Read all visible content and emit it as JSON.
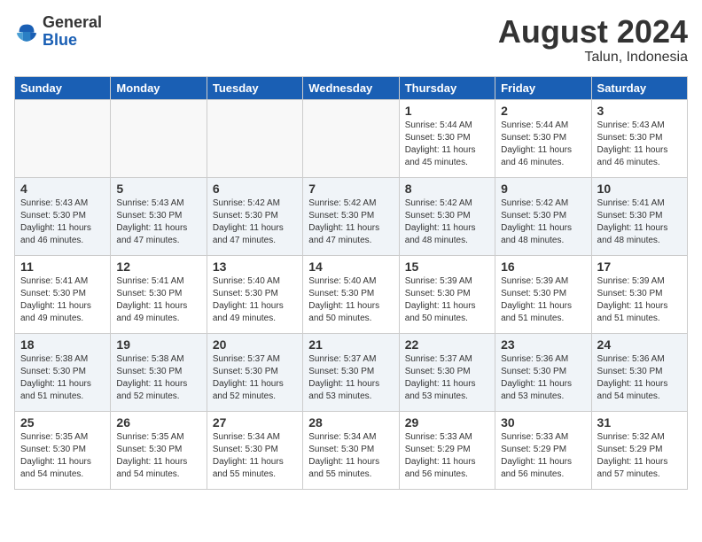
{
  "logo": {
    "general": "General",
    "blue": "Blue"
  },
  "title": {
    "month_year": "August 2024",
    "location": "Talun, Indonesia"
  },
  "headers": [
    "Sunday",
    "Monday",
    "Tuesday",
    "Wednesday",
    "Thursday",
    "Friday",
    "Saturday"
  ],
  "weeks": [
    [
      {
        "day": "",
        "empty": true
      },
      {
        "day": "",
        "empty": true
      },
      {
        "day": "",
        "empty": true
      },
      {
        "day": "",
        "empty": true
      },
      {
        "day": "1",
        "sunrise": "5:44 AM",
        "sunset": "5:30 PM",
        "daylight": "11 hours and 45 minutes."
      },
      {
        "day": "2",
        "sunrise": "5:44 AM",
        "sunset": "5:30 PM",
        "daylight": "11 hours and 46 minutes."
      },
      {
        "day": "3",
        "sunrise": "5:43 AM",
        "sunset": "5:30 PM",
        "daylight": "11 hours and 46 minutes."
      }
    ],
    [
      {
        "day": "4",
        "sunrise": "5:43 AM",
        "sunset": "5:30 PM",
        "daylight": "11 hours and 46 minutes."
      },
      {
        "day": "5",
        "sunrise": "5:43 AM",
        "sunset": "5:30 PM",
        "daylight": "11 hours and 47 minutes."
      },
      {
        "day": "6",
        "sunrise": "5:42 AM",
        "sunset": "5:30 PM",
        "daylight": "11 hours and 47 minutes."
      },
      {
        "day": "7",
        "sunrise": "5:42 AM",
        "sunset": "5:30 PM",
        "daylight": "11 hours and 47 minutes."
      },
      {
        "day": "8",
        "sunrise": "5:42 AM",
        "sunset": "5:30 PM",
        "daylight": "11 hours and 48 minutes."
      },
      {
        "day": "9",
        "sunrise": "5:42 AM",
        "sunset": "5:30 PM",
        "daylight": "11 hours and 48 minutes."
      },
      {
        "day": "10",
        "sunrise": "5:41 AM",
        "sunset": "5:30 PM",
        "daylight": "11 hours and 48 minutes."
      }
    ],
    [
      {
        "day": "11",
        "sunrise": "5:41 AM",
        "sunset": "5:30 PM",
        "daylight": "11 hours and 49 minutes."
      },
      {
        "day": "12",
        "sunrise": "5:41 AM",
        "sunset": "5:30 PM",
        "daylight": "11 hours and 49 minutes."
      },
      {
        "day": "13",
        "sunrise": "5:40 AM",
        "sunset": "5:30 PM",
        "daylight": "11 hours and 49 minutes."
      },
      {
        "day": "14",
        "sunrise": "5:40 AM",
        "sunset": "5:30 PM",
        "daylight": "11 hours and 50 minutes."
      },
      {
        "day": "15",
        "sunrise": "5:39 AM",
        "sunset": "5:30 PM",
        "daylight": "11 hours and 50 minutes."
      },
      {
        "day": "16",
        "sunrise": "5:39 AM",
        "sunset": "5:30 PM",
        "daylight": "11 hours and 51 minutes."
      },
      {
        "day": "17",
        "sunrise": "5:39 AM",
        "sunset": "5:30 PM",
        "daylight": "11 hours and 51 minutes."
      }
    ],
    [
      {
        "day": "18",
        "sunrise": "5:38 AM",
        "sunset": "5:30 PM",
        "daylight": "11 hours and 51 minutes."
      },
      {
        "day": "19",
        "sunrise": "5:38 AM",
        "sunset": "5:30 PM",
        "daylight": "11 hours and 52 minutes."
      },
      {
        "day": "20",
        "sunrise": "5:37 AM",
        "sunset": "5:30 PM",
        "daylight": "11 hours and 52 minutes."
      },
      {
        "day": "21",
        "sunrise": "5:37 AM",
        "sunset": "5:30 PM",
        "daylight": "11 hours and 53 minutes."
      },
      {
        "day": "22",
        "sunrise": "5:37 AM",
        "sunset": "5:30 PM",
        "daylight": "11 hours and 53 minutes."
      },
      {
        "day": "23",
        "sunrise": "5:36 AM",
        "sunset": "5:30 PM",
        "daylight": "11 hours and 53 minutes."
      },
      {
        "day": "24",
        "sunrise": "5:36 AM",
        "sunset": "5:30 PM",
        "daylight": "11 hours and 54 minutes."
      }
    ],
    [
      {
        "day": "25",
        "sunrise": "5:35 AM",
        "sunset": "5:30 PM",
        "daylight": "11 hours and 54 minutes."
      },
      {
        "day": "26",
        "sunrise": "5:35 AM",
        "sunset": "5:30 PM",
        "daylight": "11 hours and 54 minutes."
      },
      {
        "day": "27",
        "sunrise": "5:34 AM",
        "sunset": "5:30 PM",
        "daylight": "11 hours and 55 minutes."
      },
      {
        "day": "28",
        "sunrise": "5:34 AM",
        "sunset": "5:30 PM",
        "daylight": "11 hours and 55 minutes."
      },
      {
        "day": "29",
        "sunrise": "5:33 AM",
        "sunset": "5:29 PM",
        "daylight": "11 hours and 56 minutes."
      },
      {
        "day": "30",
        "sunrise": "5:33 AM",
        "sunset": "5:29 PM",
        "daylight": "11 hours and 56 minutes."
      },
      {
        "day": "31",
        "sunrise": "5:32 AM",
        "sunset": "5:29 PM",
        "daylight": "11 hours and 57 minutes."
      }
    ]
  ],
  "labels": {
    "sunrise": "Sunrise:",
    "sunset": "Sunset:",
    "daylight": "Daylight:"
  }
}
